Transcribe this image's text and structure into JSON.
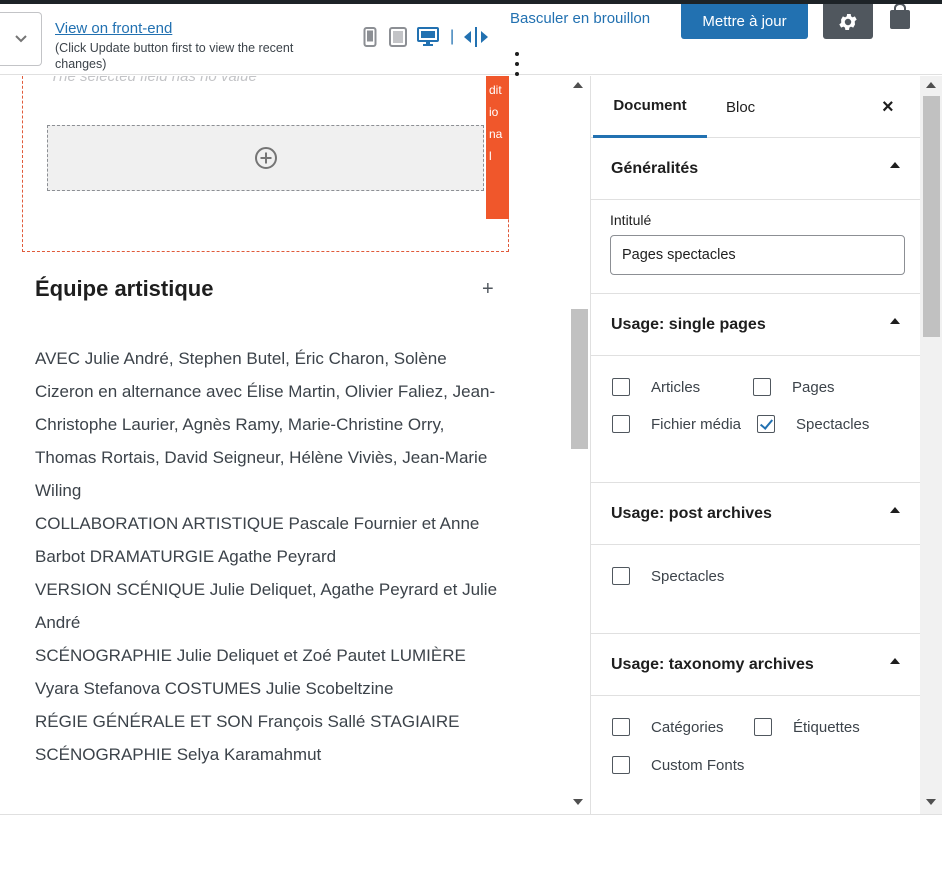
{
  "header": {
    "view_link": "View on front-end",
    "view_note": "(Click Update button first to view the recent changes)",
    "device_separator": "|",
    "draft_label": "Basculer en brouillon",
    "update_label": "Mettre à jour"
  },
  "editor": {
    "ghost_text": "The selected field has no value",
    "orange_tab_lines": [
      "dit",
      "io",
      "na",
      "l"
    ],
    "section_title": "Équipe artistique",
    "section_plus": "+",
    "credits": [
      "AVEC Julie André, Stephen Butel, Éric Charon, Solène Cizeron en alternance avec Élise Martin, Olivier Faliez, Jean-Christophe Laurier, Agnès Ramy, Marie-Christine Orry, Thomas Rortais, David Seigneur, Hélène Viviès, Jean-Marie Wiling",
      "COLLABORATION ARTISTIQUE Pascale Fournier et Anne Barbot DRAMATURGIE Agathe Peyrard",
      "VERSION SCÉNIQUE Julie Deliquet, Agathe Peyrard et Julie André",
      "SCÉNOGRAPHIE Julie Deliquet et Zoé Pautet LUMIÈRE Vyara Stefanova COSTUMES Julie Scobeltzine",
      "RÉGIE GÉNÉRALE ET SON François Sallé STAGIAIRE SCÉNOGRAPHIE Selya Karamahmut"
    ]
  },
  "sidebar": {
    "tabs": {
      "document": "Document",
      "bloc": "Bloc"
    },
    "close": "×",
    "generalites": {
      "title": "Généralités",
      "field_label": "Intitulé",
      "field_value": "Pages spectacles"
    },
    "single_pages": {
      "title": "Usage: single pages",
      "options": [
        {
          "label": "Articles",
          "checked": false
        },
        {
          "label": "Pages",
          "checked": false
        },
        {
          "label": "Fichier média",
          "checked": false
        },
        {
          "label": "Spectacles",
          "checked": true
        }
      ]
    },
    "post_archives": {
      "title": "Usage: post archives",
      "options": [
        {
          "label": "Spectacles",
          "checked": false
        }
      ]
    },
    "taxonomy_archives": {
      "title": "Usage: taxonomy archives",
      "options": [
        {
          "label": "Catégories",
          "checked": false
        },
        {
          "label": "Étiquettes",
          "checked": false
        },
        {
          "label": "Custom Fonts",
          "checked": false
        }
      ]
    }
  },
  "colors": {
    "accent": "#2271b1",
    "orange": "#f0572b",
    "gear_bg": "#50575e"
  }
}
